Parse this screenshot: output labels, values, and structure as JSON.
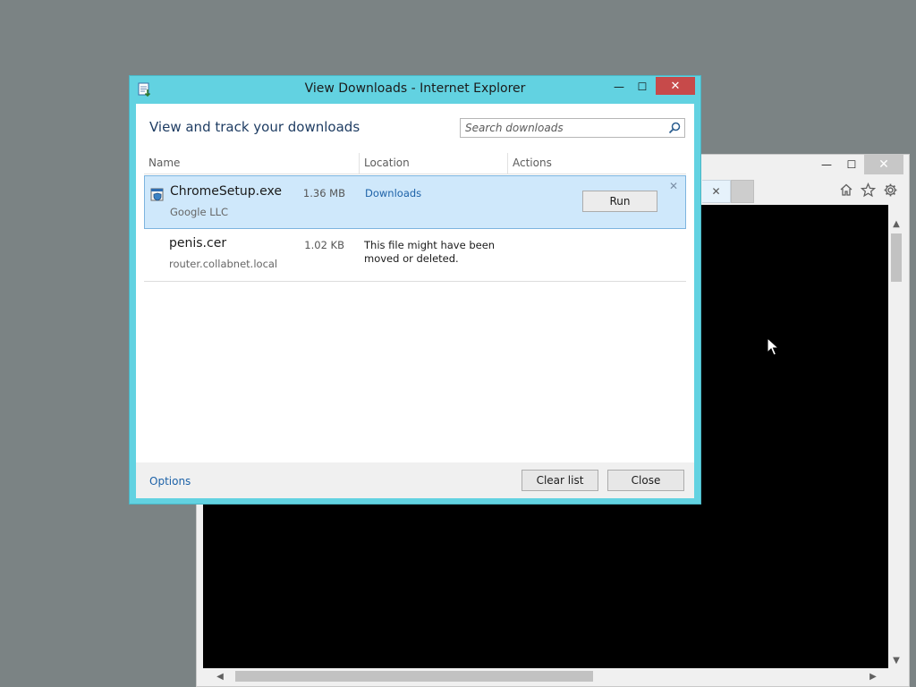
{
  "desktop": {
    "background_color": "#7b8384"
  },
  "browser_window": {
    "caption_buttons": {
      "minimize": "—",
      "maximize": "☐",
      "close": "✕"
    },
    "tab_close": "✕",
    "toolbar_icons": [
      "home-icon",
      "favorites-star-icon",
      "settings-gear-icon"
    ],
    "scroll": {
      "up": "▲",
      "down": "▼",
      "left": "◀",
      "right": "▶"
    }
  },
  "downloads_dialog": {
    "title": "View Downloads - Internet Explorer",
    "caption_buttons": {
      "minimize": "—",
      "maximize": "☐",
      "close": "✕"
    },
    "heading": "View and track your downloads",
    "search": {
      "placeholder": "Search downloads",
      "value": ""
    },
    "columns": {
      "name": "Name",
      "location": "Location",
      "actions": "Actions"
    },
    "items": [
      {
        "name": "ChromeSetup.exe",
        "source": "Google LLC",
        "size": "1.36 MB",
        "location": "Downloads",
        "action": "Run",
        "dismiss": "✕",
        "selected": true
      },
      {
        "name": "penis.cer",
        "source": "router.collabnet.local",
        "size": "1.02 KB",
        "location": "This file might have been moved or deleted."
      }
    ],
    "footer": {
      "options": "Options",
      "clear_list": "Clear list",
      "close": "Close"
    },
    "colors": {
      "frame": "#62d2e1",
      "close_button": "#c74a4a",
      "selected_row": "#cfe8fb",
      "link": "#1d62a8"
    }
  }
}
